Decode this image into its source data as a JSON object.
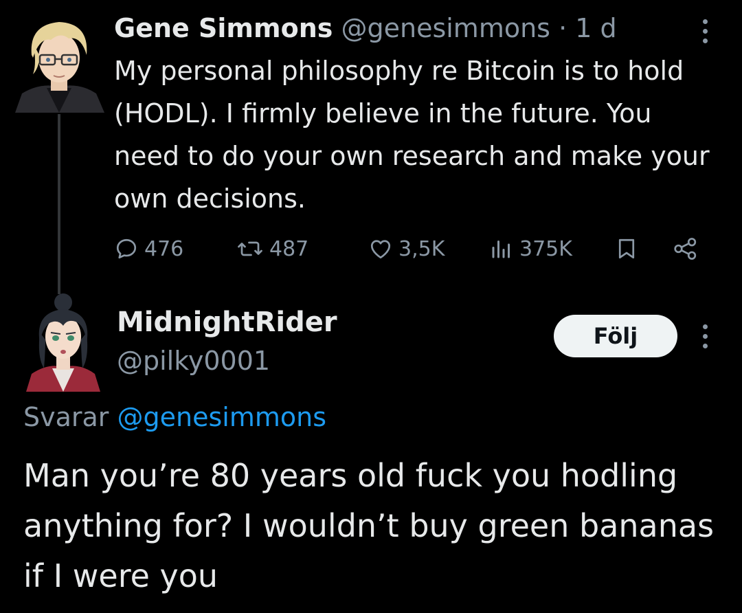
{
  "tweet": {
    "author_name": "Gene Simmons",
    "author_handle": "@genesimmons",
    "separator": "·",
    "time": "1 d",
    "text": "My personal philosophy re Bitcoin is to hold (HODL). I firmly believe in the future. You need to do your own research and make your own decisions.",
    "stats": {
      "replies": "476",
      "reposts": "487",
      "likes": "3,5K",
      "views": "375K"
    }
  },
  "reply": {
    "author_name": "MidnightRider",
    "author_handle": "@pilky0001",
    "follow_label": "Följ",
    "replying_prefix": "Svarar",
    "replying_to": "@genesimmons",
    "text": "Man you’re 80 years old fuck you hodling anything for? I wouldn’t buy green bananas if I were you"
  },
  "icons": [
    "more-vertical-icon",
    "reply-icon",
    "repost-icon",
    "like-icon",
    "views-icon",
    "bookmark-icon",
    "share-icon"
  ],
  "colors": {
    "background": "#000000",
    "text": "#e7e9ea",
    "secondary": "#8b98a5",
    "link": "#1d9bf0",
    "thread_line": "#333639"
  }
}
